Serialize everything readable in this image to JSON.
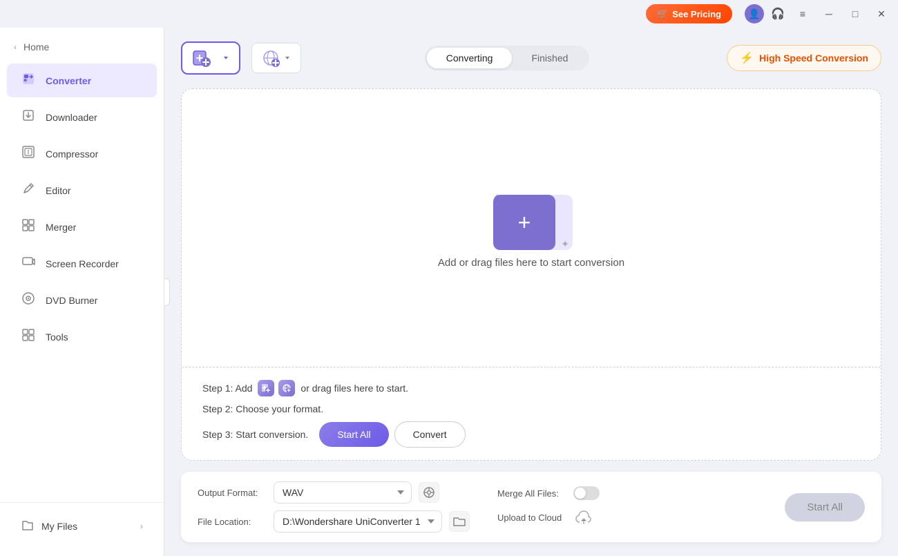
{
  "titlebar": {
    "see_pricing_label": "See Pricing",
    "minimize_label": "─",
    "maximize_label": "□",
    "close_label": "✕",
    "menu_label": "≡"
  },
  "sidebar": {
    "home_label": "Home",
    "items": [
      {
        "id": "converter",
        "label": "Converter",
        "icon": "⬛",
        "active": true
      },
      {
        "id": "downloader",
        "label": "Downloader",
        "icon": "⬇"
      },
      {
        "id": "compressor",
        "label": "Compressor",
        "icon": "🗜"
      },
      {
        "id": "editor",
        "label": "Editor",
        "icon": "✂"
      },
      {
        "id": "merger",
        "label": "Merger",
        "icon": "⊞"
      },
      {
        "id": "screen-recorder",
        "label": "Screen Recorder",
        "icon": "⬛"
      },
      {
        "id": "dvd-burner",
        "label": "DVD Burner",
        "icon": "⬛"
      },
      {
        "id": "tools",
        "label": "Tools",
        "icon": "⊞"
      }
    ],
    "my_files_label": "My Files"
  },
  "toolbar": {
    "converting_tab": "Converting",
    "finished_tab": "Finished",
    "high_speed_label": "High Speed Conversion"
  },
  "drop_zone": {
    "instruction_text": "Add or drag files here to start conversion",
    "step1_prefix": "Step 1: Add",
    "step1_suffix": "or drag files here to start.",
    "step2": "Step 2: Choose your format.",
    "step3_prefix": "Step 3: Start conversion.",
    "start_all_label": "Start All",
    "convert_label": "Convert"
  },
  "bottom_bar": {
    "output_format_label": "Output Format:",
    "format_value": "WAV",
    "file_location_label": "File Location:",
    "location_value": "D:\\Wondershare UniConverter 1",
    "merge_all_label": "Merge All Files:",
    "upload_cloud_label": "Upload to Cloud",
    "start_all_label": "Start All"
  }
}
